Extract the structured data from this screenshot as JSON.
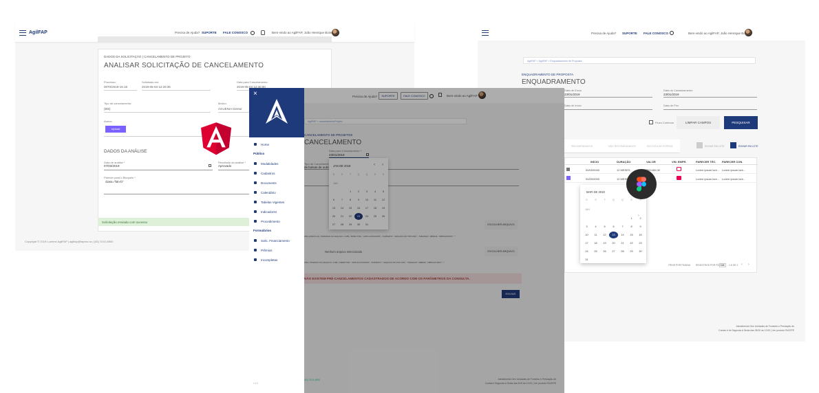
{
  "screen_a": {
    "brand": "AgilFAP",
    "help": "Precisa de Ajuda?",
    "support": "SUPORTE",
    "contact": "FALE CONOSCO",
    "welcome": "Bem-vindo ao AgilFAP, João Henrique Boine",
    "breadcrumb": "DADOS DA SOLICITAÇÃO | CANCELAMENTO DE PROJETO",
    "title": "ANALISAR SOLICITAÇÃO DE CANCELAMENTO",
    "fields": {
      "processo_label": "Processo:",
      "processo_value": "0070/2019-19.18",
      "solicitado_label": "Solicitado em:",
      "solicitado_value": "2019-05-03 12:20:35",
      "data_cancel_label": "Data para Cancelamento:",
      "data_cancel_value": "2019-05-03 12:30:00",
      "tipo_label": "Tipo de cancelamento:",
      "tipo_value": "(Bl6)",
      "motivo_label": "Motivo:",
      "motivo_value": "AGUENIA Diretor",
      "anexo_label": "Anexo:",
      "upload_label": "Upload"
    },
    "analysis_title": "DADOS DA ANÁLISE",
    "analysis": {
      "data_label": "Data de análise *",
      "data_value": "07/03/2019",
      "result_label": "Resultado da análise *",
      "result_value": "Aprovado",
      "parecer_label": "Parecer para o Bloqueio *",
      "parecer_value": "class=\"btn-b\""
    },
    "success": "Solicitação enviada com sucesso",
    "footer": "Copyright © 2019 Luzerne AgilFAP | agilfap@fapesc.sc | (81) 3101-6600"
  },
  "screen_b": {
    "help": "Precisa de Ajuda?",
    "support": "SUPORTE",
    "contact": "FALE CONOSCO",
    "welcome": "Bem-vindo ao AgilFAP",
    "breadcrumb": "AgilFAP > cancelamentoProjeto",
    "subtitle": "CANCELAMENTO DE PROJETOS",
    "title": "CANCELAMENTO",
    "date_label": "Data para Cancelamento *",
    "date_value": "23/01/2019",
    "select_label": "Tipo de Cancelamento *",
    "select_value": "de bolsas de outro p",
    "calendar": {
      "header": "JAN DE 2019",
      "weekdays": [
        "D",
        "S",
        "T",
        "Q",
        "Q",
        "S",
        "S"
      ],
      "month_label": "JAN",
      "weeks": [
        [
          "",
          "",
          "1",
          "2",
          "3",
          "4",
          "5"
        ],
        [
          "6",
          "7",
          "8",
          "9",
          "10",
          "11",
          "12"
        ],
        [
          "13",
          "14",
          "15",
          "16",
          "17",
          "18",
          "19"
        ],
        [
          "20",
          "21",
          "22",
          "23",
          "24",
          "25",
          "26"
        ],
        [
          "27",
          "28",
          "29",
          "30",
          "31",
          "",
          ""
        ]
      ],
      "selected": "23"
    },
    "choose_file": "ESCOLHER ARQUIVO",
    "no_file": "Nenhum arquivo selecionado",
    "file_hint_1": "PDF (ANEXO-01) | TAMANHO DO ARQUIVO: 4 MB | \"MIMETYPE\": \"APPLICATION/PDF\", \"FORMATO\": \"ARQUIVO DO TIPO PDF\", \"TAMANHO\": MB0043, \"OBRIGATORIO\": \"\"",
    "file_hint_2": "PDF | TAMANHO DO ARQUIVO: 4 MB | \"MIMETYPE\": \"APPLICATION/PDF\", \"FORMATO\": \"ARQUIVO DO TIPO PDF\", \"TAMANHO\": MB0043, \"OBRIGATORIO\": \"\"",
    "alert": "NÃO EXISTEM PRÉ-CANCELAMENTOS CADASTRADOS DE ACORDO COM OS PARÂMETROS DA CONSULTA.",
    "send": "ENVIAR",
    "footer_left": "(81) 3101-6600",
    "footer_right_1": "Atendimento Gen Unidades de Fomento e Prestação de",
    "footer_right_2": "Contas é Segunda à Sexta das 8:00 às 12:00 | Um produto FACEPE",
    "drawer": {
      "items_top": [
        {
          "label": "Home"
        }
      ],
      "section_1": "Público",
      "items_1": [
        {
          "label": "Modalidades"
        },
        {
          "label": "Cadastros"
        },
        {
          "label": "Documents"
        },
        {
          "label": "Calendário"
        },
        {
          "label": "Tabelas Vigentes"
        },
        {
          "label": "Indicadores"
        },
        {
          "label": "Procedimento"
        }
      ],
      "section_2": "Formulários",
      "items_2": [
        {
          "label": "Solic. Financiamento"
        },
        {
          "label": "Prêmios"
        },
        {
          "label": "Incompletas"
        }
      ],
      "footer": "v 1.0"
    }
  },
  "screen_c": {
    "help": "Precisa de Ajuda?",
    "support": "SUPORTE",
    "contact": "FALE CONOSCO",
    "welcome": "Bem-vindo ao AgilFAP, João Henrique Boine",
    "breadcrumb": "AgilFAP > AgilFAP > Enquadramento de Proposta",
    "subtitle": "ENQUADRAMENTO DE PROPOSTA",
    "title": "ENQUADRAMENTO",
    "filters": {
      "f1_label": "Data de Envio",
      "f1_value": "23/01/2019",
      "f2_label": "Data do Cadastramento",
      "f2_value": "23/01/2019",
      "f3_label": "Data de Início",
      "f4_label": "Data de Fim",
      "check_label": "Fluxo Contínuo",
      "clear": "LIMPAR CAMPOS",
      "search": "PESQUISAR"
    },
    "tabs": [
      "RECOMENDADOS",
      "NÃO RECOMENDADOS",
      "EM LISTA DE ESPERA"
    ],
    "batch_label": "ENVIAR EM LOTE",
    "send_batch": "ENVIAR EM LOTE",
    "table": {
      "headers": [
        "INÍCIO",
        "DURAÇÃO",
        "VALOR",
        "VIN. EMPR.",
        "PARECER TÉC.",
        "PARECER CON."
      ],
      "rows": [
        [
          "00/00/0000",
          "12 MESES",
          "R$99.000,00",
          "",
          "Lorem ipsum lore...",
          "Lorem ipsum lore..."
        ],
        [
          "00/00/0000",
          "12 MESES",
          "",
          "",
          "Lorem ipsum lore...",
          "Lorem ipsum lore..."
        ]
      ]
    },
    "calendar": {
      "header": "MAR DE 2019",
      "weekdays": [
        "D",
        "S",
        "T",
        "Q",
        "Q",
        "S",
        "S"
      ],
      "month_label": "JAN",
      "weeks": [
        [
          "",
          "",
          "",
          "",
          "",
          "1",
          "2"
        ],
        [
          "3",
          "4",
          "5",
          "6",
          "7",
          "8",
          "9"
        ],
        [
          "10",
          "11",
          "12",
          "13",
          "14",
          "15",
          "16"
        ],
        [
          "17",
          "18",
          "19",
          "20",
          "21",
          "22",
          "23"
        ],
        [
          "24",
          "25",
          "26",
          "27",
          "28",
          "29",
          "30"
        ],
        [
          "31",
          "",
          "",
          "",
          "",
          "",
          ""
        ]
      ],
      "extra": [
        [
          "3",
          "4",
          "5",
          "6",
          "7",
          "8"
        ],
        [
          "10",
          "11",
          "12",
          "13",
          "14",
          "15"
        ],
        [
          "16",
          "17",
          "18",
          "19",
          "20",
          "21",
          "22"
        ],
        [
          "23",
          "24",
          "25",
          "26",
          "27",
          "28",
          "29"
        ],
        [
          "30",
          "31"
        ]
      ],
      "selected": "13"
    },
    "pagination_label": "ITENS POR PÁGINA",
    "pagination_rows": "REGISTROS POR PÁGINA",
    "pagination_value": "10",
    "pagination_range": "1-5 DE 2",
    "footer_1": "Atendimento Gen Unidades de Fomento e Prestação de",
    "footer_2": "Contas é de Segunda à Sexta das 08:00 às 12:00 | Um produto FACEPE"
  },
  "colors": {
    "navy": "#1f3a7a",
    "success_bg": "#dff0d8",
    "alert_bg": "#f2dede",
    "angular_red": "#dd0031",
    "upload_purple": "#7b61ff",
    "figma_bg": "#2c2c2c"
  },
  "icons": [
    "hamburger-icon",
    "settings-icon",
    "notification-icon",
    "close-icon",
    "calendar-icon",
    "chevron-left-icon",
    "chevron-right-icon",
    "angular-logo",
    "figma-logo",
    "search-icon"
  ]
}
